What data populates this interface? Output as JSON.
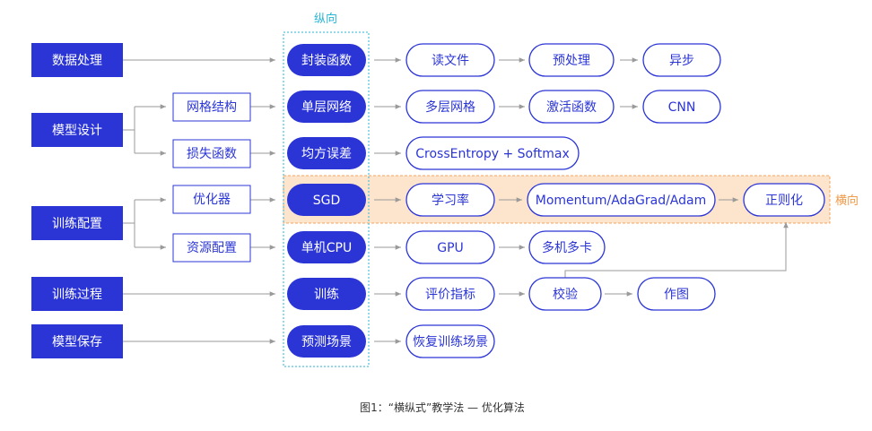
{
  "labels": {
    "vertical": "纵向",
    "horizontal": "横向"
  },
  "caption": "图1：“横纵式”教学法 — 优化算法",
  "stages": [
    {
      "id": "stage-data",
      "label": "数据处理"
    },
    {
      "id": "stage-model",
      "label": "模型设计"
    },
    {
      "id": "stage-train-config",
      "label": "训练配置"
    },
    {
      "id": "stage-train-process",
      "label": "训练过程"
    },
    {
      "id": "stage-save",
      "label": "模型保存"
    }
  ],
  "sub_items": [
    {
      "id": "sub-network",
      "label": "网格结构"
    },
    {
      "id": "sub-loss",
      "label": "损失函数"
    },
    {
      "id": "sub-optimizer",
      "label": "优化器"
    },
    {
      "id": "sub-resource",
      "label": "资源配置"
    }
  ],
  "core_items": [
    {
      "id": "core-wrap",
      "label": "封装函数"
    },
    {
      "id": "core-single-layer",
      "label": "单层网络"
    },
    {
      "id": "core-mse",
      "label": "均方误差"
    },
    {
      "id": "core-sgd",
      "label": "SGD"
    },
    {
      "id": "core-cpu",
      "label": "单机CPU"
    },
    {
      "id": "core-train",
      "label": "训练"
    },
    {
      "id": "core-predict",
      "label": "预测场景"
    }
  ],
  "steps": [
    {
      "id": "step-read-file",
      "label": "读文件"
    },
    {
      "id": "step-preprocess",
      "label": "预处理"
    },
    {
      "id": "step-async",
      "label": "异步"
    },
    {
      "id": "step-multilayer",
      "label": "多层网格"
    },
    {
      "id": "step-activation",
      "label": "激活函数"
    },
    {
      "id": "step-cnn",
      "label": "CNN"
    },
    {
      "id": "step-crossentropy",
      "label": "CrossEntropy + Softmax"
    },
    {
      "id": "step-learning-rate",
      "label": "学习率"
    },
    {
      "id": "step-momentum",
      "label": "Momentum/AdaGrad/Adam"
    },
    {
      "id": "step-regularization",
      "label": "正则化"
    },
    {
      "id": "step-gpu",
      "label": "GPU"
    },
    {
      "id": "step-multi-gpu",
      "label": "多机多卡"
    },
    {
      "id": "step-eval-metric",
      "label": "评价指标"
    },
    {
      "id": "step-validate",
      "label": "校验"
    },
    {
      "id": "step-plot",
      "label": "作图"
    },
    {
      "id": "step-restore-scene",
      "label": "恢复训练场景"
    }
  ]
}
